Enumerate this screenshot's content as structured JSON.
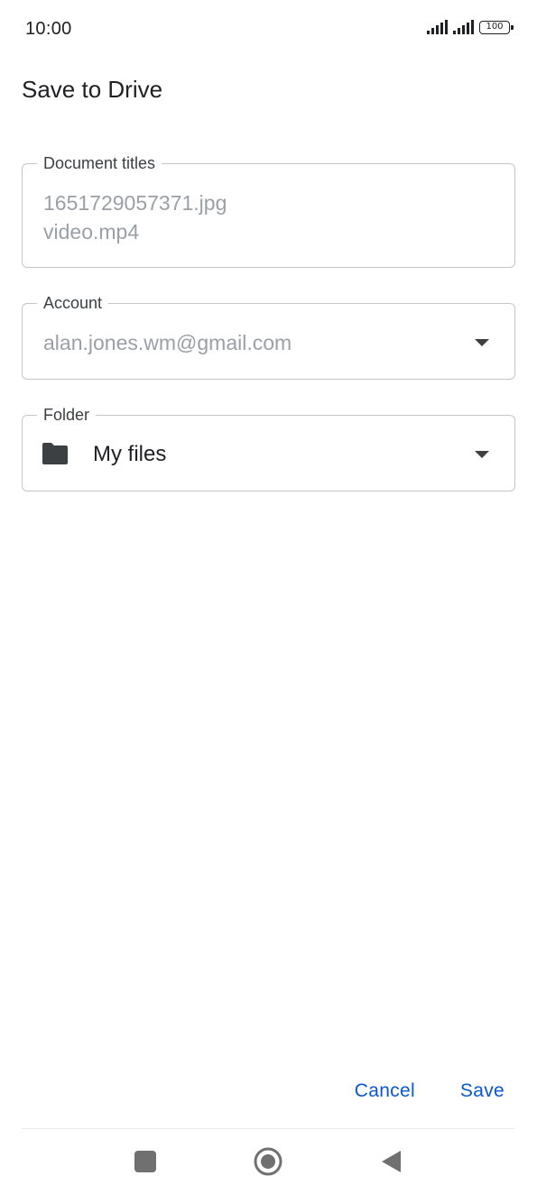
{
  "status_bar": {
    "time": "10:00",
    "battery": "100"
  },
  "header": {
    "title": "Save to Drive"
  },
  "form": {
    "document_titles": {
      "label": "Document titles",
      "lines": [
        "1651729057371.jpg",
        "video.mp4"
      ]
    },
    "account": {
      "label": "Account",
      "value": "alan.jones.wm@gmail.com"
    },
    "folder": {
      "label": "Folder",
      "value": "My files",
      "icon": "folder-icon"
    }
  },
  "actions": {
    "cancel_label": "Cancel",
    "save_label": "Save"
  },
  "nav_bar": {
    "recents_icon": "square-icon",
    "home_icon": "circle-icon",
    "back_icon": "triangle-back-icon"
  },
  "colors": {
    "accent": "#0b57d0",
    "field_border": "#c4c7c5",
    "placeholder_text": "#9aa0a6"
  }
}
